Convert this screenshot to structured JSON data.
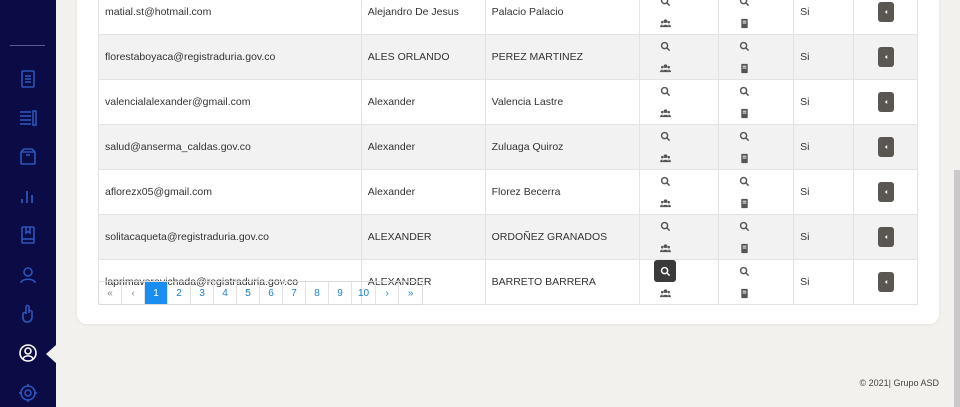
{
  "sidebar": {
    "icons": [
      "document-icon",
      "list-icon",
      "box-icon",
      "bar-chart-icon",
      "book-icon",
      "user-icon",
      "hand-icon",
      "user-circle-icon",
      "settings-icon"
    ]
  },
  "table": {
    "rows": [
      {
        "email": "matial.st@hotmail.com",
        "name": "Alejandro De Jesus",
        "lastname": "Palacio Palacio",
        "si": "Si"
      },
      {
        "email": "florestaboyaca@registraduria.gov.co",
        "name": "ALES ORLANDO",
        "lastname": "PEREZ MARTINEZ",
        "si": "Si"
      },
      {
        "email": "valencialalexander@gmail.com",
        "name": "Alexander",
        "lastname": "Valencia Lastre",
        "si": "Si"
      },
      {
        "email": "salud@anserma_caldas.gov.co",
        "name": "Alexander",
        "lastname": "Zuluaga Quiroz",
        "si": "Si"
      },
      {
        "email": "aflorezx05@gmail.com",
        "name": "Alexander",
        "lastname": "Florez Becerra",
        "si": "Si"
      },
      {
        "email": "solitacaqueta@registraduria.gov.co",
        "name": "ALEXANDER",
        "lastname": "ORDOÑEZ GRANADOS",
        "si": "Si"
      },
      {
        "email": "laprimaveravichada@registraduria.gov.co",
        "name": "ALEXANDER",
        "lastname": "BARRETO BARRERA",
        "si": "Si"
      }
    ]
  },
  "pagination": {
    "first": "«",
    "prev": "‹",
    "pages": [
      "1",
      "2",
      "3",
      "4",
      "5",
      "6",
      "7",
      "8",
      "9",
      "10"
    ],
    "current": "1",
    "next": "›",
    "last": "»"
  },
  "footer": {
    "text": "© 2021| Grupo ASD"
  },
  "colors": {
    "sidebar_bg": "#0b0c45",
    "accent": "#1a8ef0",
    "row_button": "#5a5651"
  }
}
